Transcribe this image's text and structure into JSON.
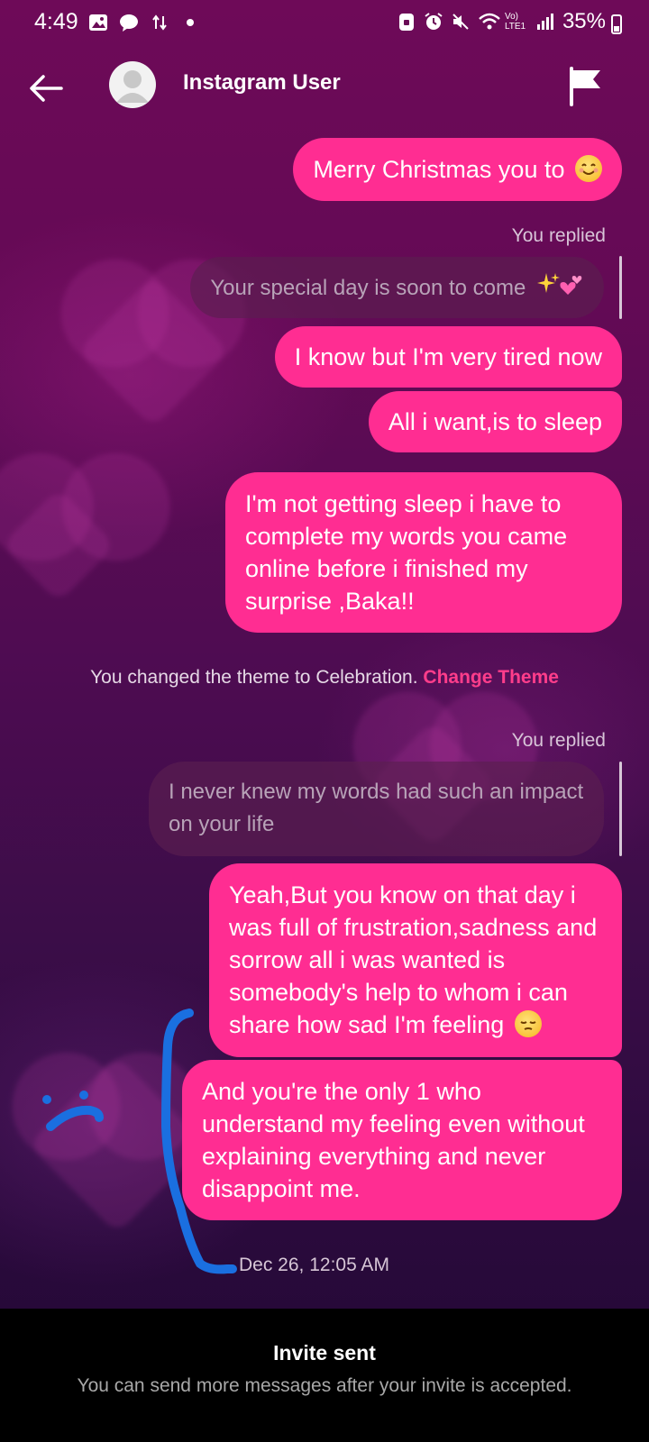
{
  "status_bar": {
    "time": "4:49",
    "battery_percent": "35%",
    "network_label": "Vo) LTE1",
    "icons_left": [
      "gallery-icon",
      "chat-icon",
      "data-transfer-icon",
      "dot-icon"
    ],
    "icons_right": [
      "lock-icon",
      "alarm-icon",
      "mute-icon",
      "wifi-icon",
      "network-icon",
      "signal-icon",
      "battery-icon"
    ]
  },
  "header": {
    "title": "Instagram User",
    "back_icon": "arrow-left-icon",
    "report_icon": "flag-icon"
  },
  "messages": [
    {
      "type": "sent",
      "text": "Merry Christmas you to",
      "emoji": "smiling-face"
    },
    {
      "type": "reply_label",
      "text": "You replied"
    },
    {
      "type": "quoted",
      "text": "Your special day is soon to come",
      "emoji": "sparkles-hearts"
    },
    {
      "type": "sent",
      "text": "I know but I'm very tired now"
    },
    {
      "type": "sent",
      "text": "All i want,is to sleep"
    },
    {
      "type": "sent",
      "text": "I'm not getting sleep i have to complete my words you came online before i finished my surprise ,Baka!!"
    },
    {
      "type": "system",
      "text": "You changed the theme to Celebration.",
      "link": "Change Theme"
    },
    {
      "type": "reply_label",
      "text": "You replied"
    },
    {
      "type": "quoted",
      "text": "I never knew my words had such an impact on your life"
    },
    {
      "type": "sent",
      "text": "Yeah,But you know on that day i was full of frustration,sadness and sorrow all i was wanted is somebody's help to whom i can share how sad I'm feeling",
      "emoji": "pensive-face"
    },
    {
      "type": "sent",
      "text": "And you're the only 1 who understand my feeling even without explaining everything and never disappoint me."
    }
  ],
  "timestamp": "Dec 26, 12:05 AM",
  "footer": {
    "title": "Invite sent",
    "subtitle": "You can send more messages after your invite is accepted."
  },
  "colors": {
    "bubble": "#ff2d92",
    "quoted_bubble": "#5a1e50",
    "link": "#ff3d8b",
    "annotation": "#1a6fe0"
  }
}
